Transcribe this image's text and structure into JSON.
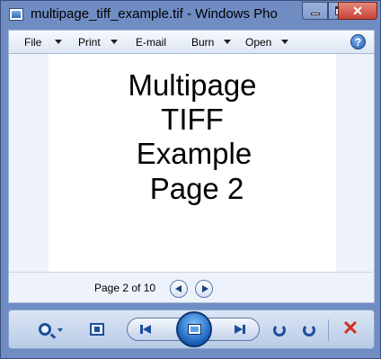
{
  "window": {
    "title": "multipage_tiff_example.tif - Windows Pho"
  },
  "title_buttons": {
    "close": "✕"
  },
  "menu": {
    "items": [
      {
        "label": "File",
        "has_arrow": true
      },
      {
        "label": "Print",
        "has_arrow": true
      },
      {
        "label": "E-mail",
        "has_arrow": false
      },
      {
        "label": "Burn",
        "has_arrow": true
      },
      {
        "label": "Open",
        "has_arrow": true
      }
    ],
    "help": "?"
  },
  "document": {
    "lines": [
      "Multipage",
      "TIFF",
      "Example",
      "Page 2"
    ]
  },
  "status": {
    "page_label": "Page 2 of 10"
  },
  "toolbar": {
    "delete": "✕"
  },
  "colors": {
    "frame": "#6f8cc3",
    "accent": "#1c4f9a",
    "close": "#c7443a",
    "delete": "#d1321f"
  }
}
